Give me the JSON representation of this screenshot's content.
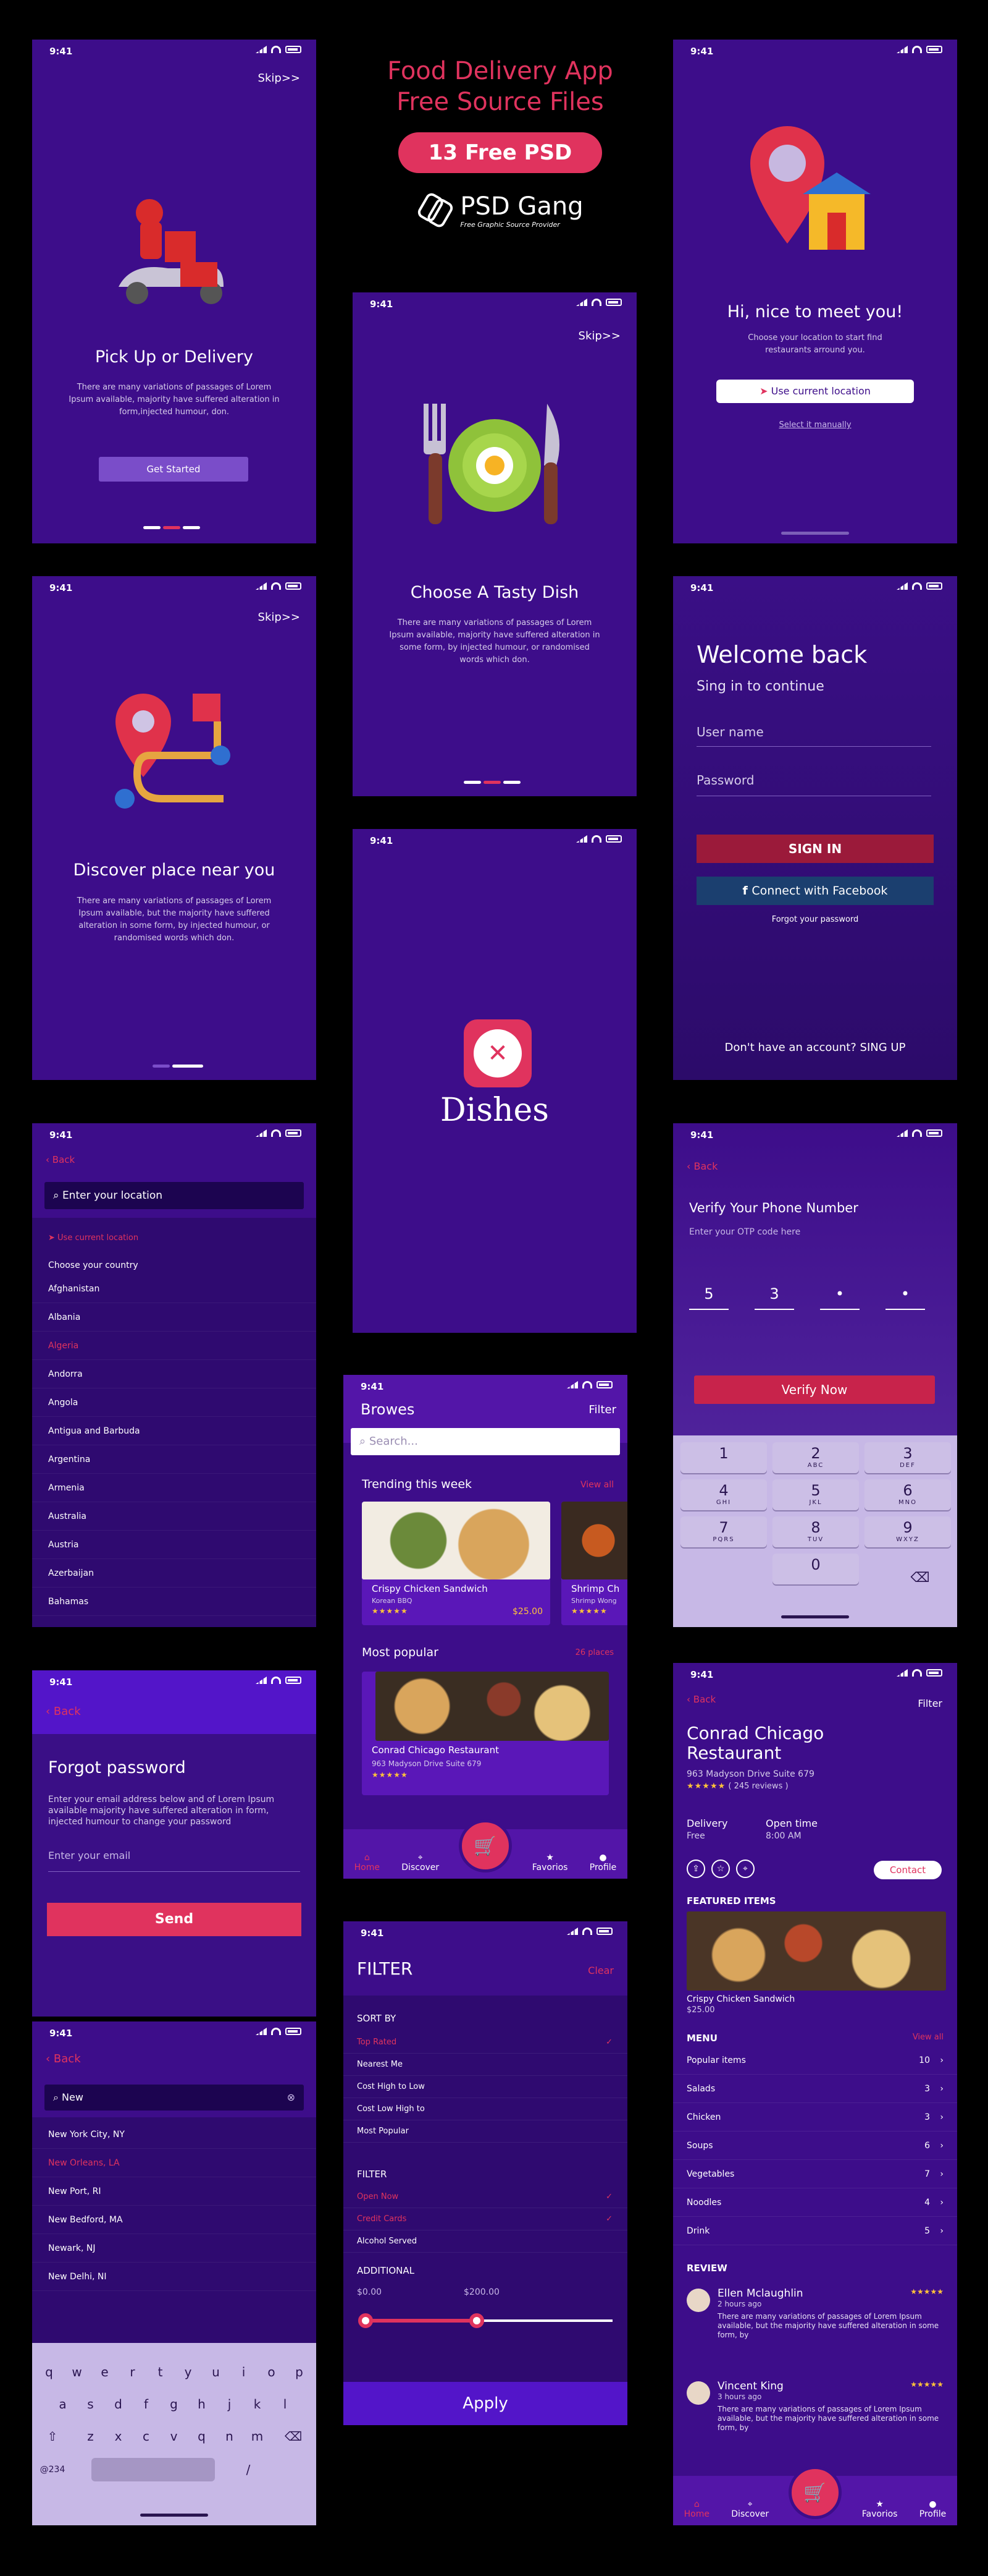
{
  "header": {
    "title1": "Food Delivery App",
    "title2": "Free Source Files",
    "badge": "13 Free PSD",
    "brand": "PSD Gang",
    "brand_sub": "Free Graphic Source Provider"
  },
  "status": {
    "time": "9:41"
  },
  "s1": {
    "skip": "Skip>>",
    "title": "Pick Up or Delivery",
    "body": "There are many variations of passages of Lorem Ipsum available,  majority have suffered alteration in  form,injected humour, don.",
    "button": "Get Started"
  },
  "s2": {
    "skip": "Skip>>",
    "title": "Choose A Tasty Dish",
    "body": "There are many variations of passages of Lorem Ipsum available,  majority have suffered alteration in some form, by injected humour, or randomised words which don."
  },
  "s3": {
    "title": "Hi, nice to meet  you!",
    "body": "Choose your location to start find restaurants arround you.",
    "button": "Use current location",
    "link": "Select it manually"
  },
  "s4": {
    "skip": "Skip>>",
    "title": "Discover place near you",
    "body": "There are many variations of passages of Lorem Ipsum available, but the majority have suffered alteration in some form, by injected humour, or randomised words which don."
  },
  "s5": {
    "title": "Dishes"
  },
  "s6": {
    "title": "Welcome back",
    "subtitle": "Sing in to continue",
    "user_placeholder": "User name",
    "pass_placeholder": "Password",
    "signin": "SIGN IN",
    "facebook": "Connect with Facebook",
    "forgot": "Forgot your password",
    "signup": "Don't have an account? SING UP"
  },
  "s7": {
    "back": "Back",
    "search_placeholder": "Enter your location",
    "use_current": "Use current location",
    "choose": "Choose your country",
    "countries": [
      "Afghanistan",
      "Albania",
      "Algeria",
      "Andorra",
      "Angola",
      "Antigua and Barbuda",
      "Argentina",
      "Armenia",
      "Australia",
      "Austria",
      "Azerbaijan",
      "Bahamas"
    ],
    "selected": "Algeria"
  },
  "s8": {
    "title": "Browes",
    "filter": "Filter",
    "search_placeholder": "Search...",
    "trending": "Trending this week",
    "view_all": "View all",
    "card1_title": "Crispy Chicken Sandwich",
    "card1_sub": "Korean BBQ",
    "card1_price": "$25.00",
    "card2_title": "Shrimp Ch",
    "card2_sub": "Shrimp Wong",
    "popular": "Most popular",
    "places": "26 places",
    "rest_title": "Conrad Chicago Restaurant",
    "rest_addr": "963 Madyson Drive Suite 679",
    "stars": "★★★★★"
  },
  "tabs": {
    "home": "Home",
    "discover": "Discover",
    "favorites": "Favorios",
    "profile": "Profile"
  },
  "s9": {
    "back": "Back",
    "title": "Verify Your Phone Number",
    "subtitle": "Enter your OTP code here",
    "digits": [
      "5",
      "3",
      "•",
      "•"
    ],
    "button": "Verify Now",
    "keys": [
      {
        "n": "1",
        "l": ""
      },
      {
        "n": "2",
        "l": "ABC"
      },
      {
        "n": "3",
        "l": "DEF"
      },
      {
        "n": "4",
        "l": "GHI"
      },
      {
        "n": "5",
        "l": "JKL"
      },
      {
        "n": "6",
        "l": "MNO"
      },
      {
        "n": "7",
        "l": "PQRS"
      },
      {
        "n": "8",
        "l": "TUV"
      },
      {
        "n": "9",
        "l": "WXYZ"
      },
      {
        "n": "0",
        "l": ""
      }
    ]
  },
  "s10": {
    "back": "Back",
    "title": "Forgot password",
    "body": "Enter your email address below and of Lorem Ipsum available  majority have suffered alteration in form, injected humour to change your password",
    "placeholder": "Enter your email",
    "button": "Send"
  },
  "s11": {
    "back": "Back",
    "search_value": "New",
    "cities": [
      "New York City, NY",
      "New Orleans, LA",
      "New Port, RI",
      "New Bedford, MA",
      "Newark, NJ",
      "New Delhi, NI"
    ],
    "selected": "New Orleans, LA",
    "kb_row1": [
      "q",
      "w",
      "e",
      "r",
      "t",
      "y",
      "u",
      "i",
      "o",
      "p"
    ],
    "kb_row2": [
      "a",
      "s",
      "d",
      "f",
      "g",
      "h",
      "j",
      "k",
      "l"
    ],
    "kb_row3": [
      "z",
      "x",
      "c",
      "v",
      "q",
      "n",
      "m"
    ],
    "kb_num": "@234",
    "kb_slash": "/"
  },
  "s12": {
    "title": "FILTER",
    "clear": "Clear",
    "sort_by": "SORT BY",
    "sort": [
      "Top Rated",
      "Nearest Me",
      "Cost High to Low",
      "Cost  Low High to",
      "Most Popular"
    ],
    "filter": "FILTER",
    "filters": [
      "Open Now",
      "Credit Cards",
      "Alcohol Served"
    ],
    "additional": "ADDITIONAL",
    "min": "$0.00",
    "max": "$200.00",
    "range_min": 0,
    "range_max": 0.45,
    "apply": "Apply"
  },
  "s13": {
    "back": "Back",
    "filter": "Filter",
    "title": "Conrad Chicago Restaurant",
    "addr": "963 Madyson Drive Suite 679",
    "reviews": "( 245 reviews )",
    "delivery_label": "Delivery",
    "delivery_val": "Free",
    "open_label": "Open time",
    "open_val": "8:00 AM",
    "contact": "Contact",
    "featured": "FEATURED ITEMS",
    "item_title": "Crispy Chicken Sandwich",
    "item_price": "$25.00",
    "menu": "MENU",
    "view_all": "View all",
    "menu_items": [
      {
        "name": "Popular items",
        "count": "10"
      },
      {
        "name": "Salads",
        "count": "3"
      },
      {
        "name": "Chicken",
        "count": "3"
      },
      {
        "name": "Soups",
        "count": "6"
      },
      {
        "name": "Vegetables",
        "count": "7"
      },
      {
        "name": "Noodles",
        "count": "4"
      },
      {
        "name": "Drink",
        "count": "5"
      }
    ],
    "review": "REVIEW",
    "reviews_list": [
      {
        "name": "Ellen Mclaughlin",
        "time": "2 hours ago",
        "text": "There are many variations of passages of Lorem Ipsum available, but the majority have suffered alteration in some form, by"
      },
      {
        "name": "Vincent King",
        "time": "3 hours ago",
        "text": "There are many variations of passages of Lorem Ipsum available, but the majority have suffered alteration in some form, by"
      }
    ]
  },
  "colors": {
    "bg": "#000000",
    "purple": "#3d0d8a",
    "accent": "#e0335e",
    "header_pink": "#e0335e"
  }
}
